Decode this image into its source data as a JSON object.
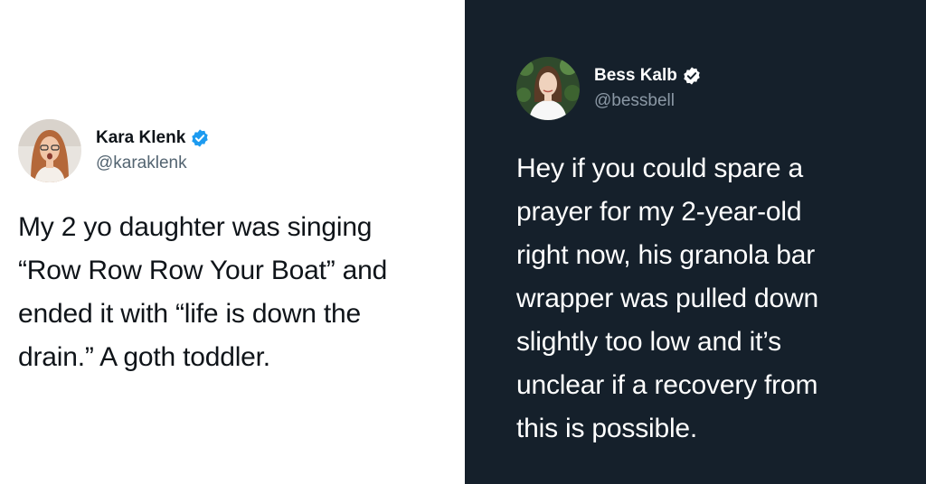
{
  "colors": {
    "left_background": "#ffffff",
    "right_background": "#15202b",
    "verified_badge": "#1d9bf0",
    "left_text": "#0f1419",
    "left_handle": "#536471",
    "right_text": "#ffffff",
    "right_handle": "#8b98a5"
  },
  "left_tweet": {
    "author": {
      "display_name": "Kara Klenk",
      "handle": "@karaklenk",
      "verified_icon": "verified-badge-icon"
    },
    "text": "My 2 yo daughter was singing\n“Row Row Row Your Boat” and\nended it with “life is down the\ndrain.” A goth toddler."
  },
  "right_tweet": {
    "author": {
      "display_name": "Bess Kalb",
      "handle": "@bessbell",
      "verified_icon": "verified-badge-icon"
    },
    "text": "Hey if you could spare a\nprayer for my 2-year-old\nright now, his granola bar\nwrapper was pulled down\nslightly too low and it’s\nunclear if a recovery from\nthis is possible."
  }
}
